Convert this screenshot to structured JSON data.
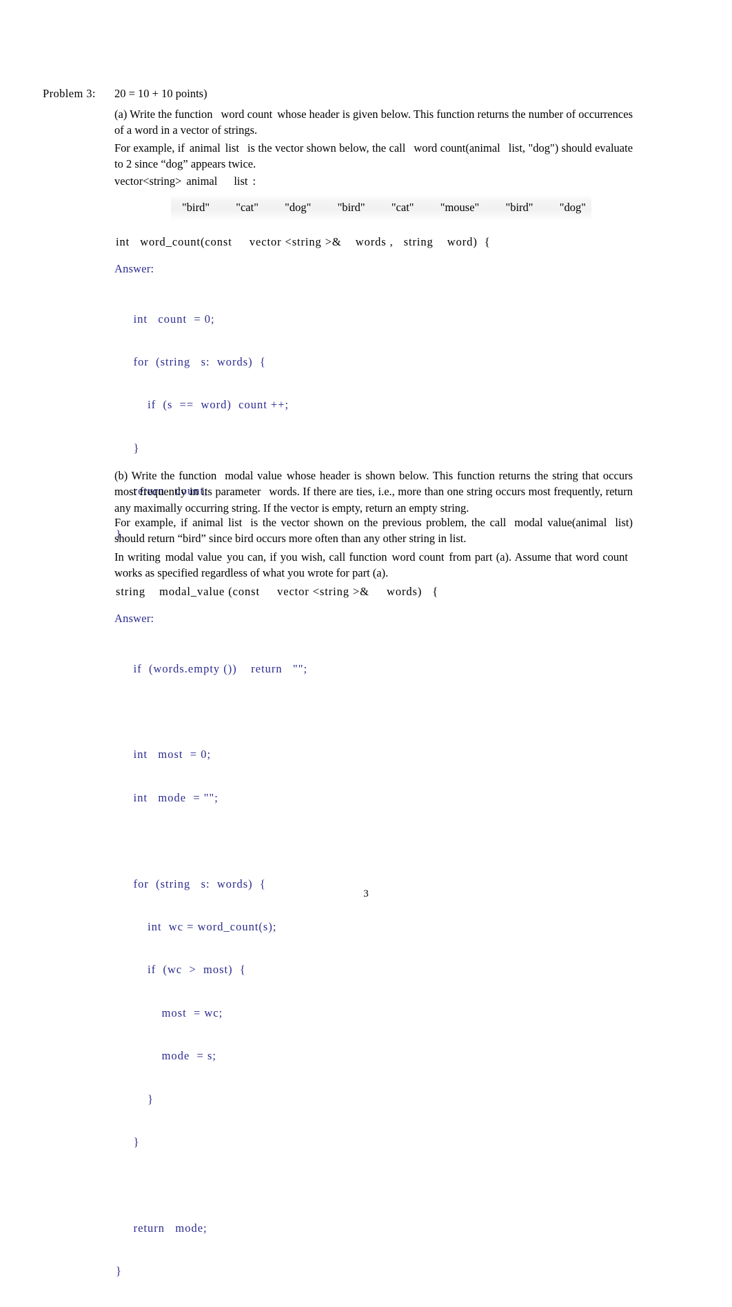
{
  "document": {
    "page_number": "3",
    "code_color": "#2b2b8f",
    "text_color": "#000000",
    "background": "#ffffff"
  },
  "problem": {
    "label": "Problem 3:",
    "points": "20 = 10 + 10 points)"
  },
  "part_a": {
    "paragraph1_pre": "(a) Write the function",
    "paragraph1_ident": "word count",
    "paragraph1_post": "whose header is given below. This function returns the number of occurrences of a word in a vector of strings.",
    "paragraph2_pre": "For example, if",
    "paragraph2_ident1": "animal",
    "paragraph2_ident2": "list",
    "paragraph2_mid": "is the vector shown below, the call",
    "paragraph2_call1": "word count(animal",
    "paragraph2_call2": "list, \"dog\")",
    "paragraph2_post": "should evaluate to 2 since “dog” appears twice.",
    "vector_decl_type": "vector<string>",
    "vector_decl_name1": "animal",
    "vector_decl_name2": "list",
    "vector_decl_colon": ":",
    "vector_values": [
      "\"bird\"",
      "\"cat\"",
      "\"dog\"",
      "\"bird\"",
      "\"cat\"",
      "\"mouse\"",
      "\"bird\"",
      "\"dog\""
    ],
    "signature": "int   word_count(const     vector <string >&    words ,   string    word)  {",
    "answer_label": "Answer:",
    "answer_code": [
      "     int   count  = 0;",
      "     for  (string   s:  words)  {",
      "         if  (s  ==  word)  count ++;",
      "     }",
      "     return   count;",
      "}"
    ]
  },
  "part_b": {
    "paragraph1_pre": "(b) Write the function",
    "paragraph1_ident": "modal value",
    "paragraph1_mid": "whose header is shown below.  This function returns the string that occurs most frequently in its parameter",
    "paragraph1_ident2": "words",
    "paragraph1_post": ". If there are ties, i.e., more than one string occurs most frequently, return any maximally occurring string. If the vector is empty, return an empty string.",
    "paragraph2_pre": "For example, if",
    "paragraph2_ident1": "animal",
    "paragraph2_ident2": "list",
    "paragraph2_mid": "is the vector shown on the previous problem, the call",
    "paragraph2_call1": "modal value(animal",
    "paragraph2_call2": "list)",
    "paragraph2_post": "should return “bird” since bird occurs more often than any other string in list.",
    "paragraph3_pre": "In writing",
    "paragraph3_ident1": "modal value",
    "paragraph3_mid": "you can, if you wish, call function",
    "paragraph3_ident2": "word count",
    "paragraph3_mid2": "from part (a). Assume that",
    "paragraph3_ident3": "word count",
    "paragraph3_post": "works as specified regardless of what you wrote for part (a).",
    "signature": "string    modal_value (const     vector <string >&     words)   {",
    "answer_label": "Answer:",
    "answer_code": [
      "     if  (words.empty ())    return   \"\";",
      "",
      "     int   most  = 0;",
      "     int   mode  = \"\";",
      "",
      "     for  (string   s:  words)  {",
      "         int  wc = word_count(s);",
      "         if  (wc  >  most)  {",
      "             most  = wc;",
      "             mode  = s;",
      "         }",
      "     }",
      "",
      "     return   mode;",
      "}"
    ]
  }
}
